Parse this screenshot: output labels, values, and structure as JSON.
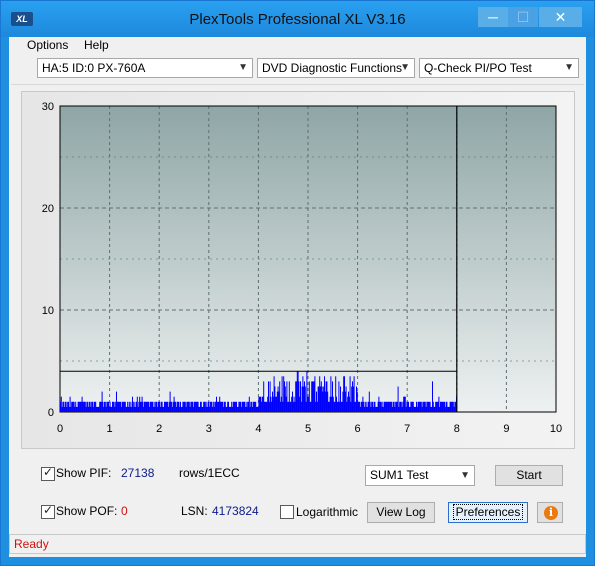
{
  "window": {
    "title": "PlexTools Professional XL V3.16",
    "app_icon_text": "XL",
    "min_glyph": "─",
    "max_glyph": "☐",
    "close_glyph": "✕"
  },
  "menu": {
    "options": "Options",
    "help": "Help"
  },
  "toolbar": {
    "drive": "HA:5 ID:0  PX-760A",
    "function": "DVD Diagnostic Functions",
    "test": "Q-Check PI/PO Test"
  },
  "chart_data": {
    "type": "bar",
    "x_ticks": [
      "0",
      "1",
      "2",
      "3",
      "4",
      "5",
      "6",
      "7",
      "8",
      "9",
      "10"
    ],
    "y_ticks": [
      "0",
      "10",
      "20",
      "30"
    ],
    "xlim": [
      0,
      10
    ],
    "ylim": [
      0,
      30
    ],
    "grid": true,
    "series": [
      {
        "color": "#0000ff",
        "segments": [
          {
            "x_range": [
              0,
              1
            ],
            "typical": 1,
            "max": 3
          },
          {
            "x_range": [
              1,
              2
            ],
            "typical": 1,
            "max": 3
          },
          {
            "x_range": [
              2,
              3
            ],
            "typical": 1,
            "max": 3
          },
          {
            "x_range": [
              3,
              4
            ],
            "typical": 1,
            "max": 4
          },
          {
            "x_range": [
              4,
              5
            ],
            "typical": 3,
            "max": 6
          },
          {
            "x_range": [
              5,
              6
            ],
            "typical": 3,
            "max": 7
          },
          {
            "x_range": [
              6,
              7
            ],
            "typical": 1,
            "max": 3
          },
          {
            "x_range": [
              7,
              8
            ],
            "typical": 1,
            "max": 4
          }
        ]
      }
    ],
    "threshold_line": 4,
    "position_marker_x": 8
  },
  "controls": {
    "show_pif_label": "Show PIF:",
    "pif_value": "27138",
    "pif_unit": "rows/1ECC",
    "show_pof_label": "Show POF:",
    "pof_value": "0",
    "lsn_label": "LSN:",
    "lsn_value": "4173824",
    "logarithmic_label": "Logarithmic",
    "test_mode": "SUM1 Test",
    "start_label": "Start",
    "view_log_label": "View Log",
    "preferences_label": "Preferences",
    "info_glyph": "i"
  },
  "status": {
    "text": "Ready"
  }
}
